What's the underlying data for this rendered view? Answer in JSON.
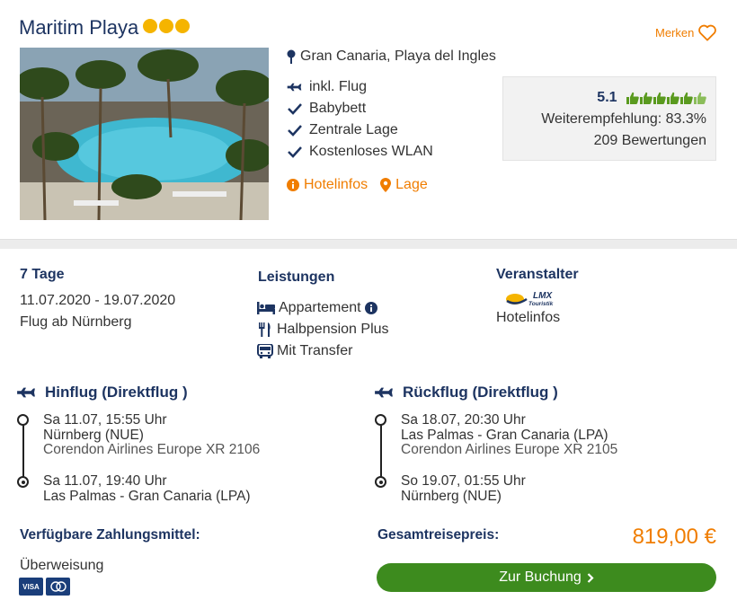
{
  "hotel": {
    "name": "Maritim Playa",
    "stars": 3,
    "bookmark_label": "Merken",
    "location": "Gran Canaria, Playa del Ingles",
    "features": [
      {
        "icon": "plane-icon",
        "label": "inkl. Flug"
      },
      {
        "icon": "check-icon",
        "label": "Babybett"
      },
      {
        "icon": "check-icon",
        "label": "Zentrale Lage"
      },
      {
        "icon": "check-icon",
        "label": "Kostenloses WLAN"
      }
    ],
    "links": {
      "hotelinfos": "Hotelinfos",
      "lage": "Lage"
    }
  },
  "rating": {
    "score": "5.1",
    "thumbs_filled": 5.1,
    "thumbs_total": 6,
    "recommendation": "Weiterempfehlung: 83.3%",
    "reviews": "209 Bewertungen"
  },
  "trip": {
    "duration": "7 Tage",
    "dates": "11.07.2020 - 19.07.2020",
    "departure": "Flug ab Nürnberg"
  },
  "leistungen": {
    "title": "Leistungen",
    "items": [
      "Appartement",
      "Halbpension Plus",
      "Mit Transfer"
    ]
  },
  "veranstalter": {
    "title": "Veranstalter",
    "logo_text": "LMX Touristik",
    "link": "Hotelinfos"
  },
  "hinflug": {
    "title": "Hinflug (Direktflug )",
    "dep_time": "Sa 11.07, 15:55 Uhr",
    "dep_airport": "Nürnberg (NUE)",
    "airline": "Corendon Airlines Europe XR 2106",
    "arr_time": "Sa 11.07, 19:40 Uhr",
    "arr_airport": "Las Palmas - Gran Canaria (LPA)"
  },
  "rueckflug": {
    "title": "Rückflug (Direktflug )",
    "dep_time": "Sa 18.07, 20:30 Uhr",
    "dep_airport": "Las Palmas - Gran Canaria (LPA)",
    "airline": "Corendon Airlines Europe XR 2105",
    "arr_time": "So 19.07, 01:55 Uhr",
    "arr_airport": "Nürnberg (NUE)"
  },
  "payment": {
    "title": "Verfügbare Zahlungsmittel:",
    "method": "Überweisung",
    "cards": [
      "VISA",
      "Mastercard"
    ]
  },
  "price": {
    "label": "Gesamtreisepreis:",
    "value": "819,00 €",
    "book_button": "Zur Buchung"
  },
  "colors": {
    "navy": "#1d3461",
    "orange": "#f07d00",
    "green": "#3d8b1e",
    "star": "#f5b400"
  }
}
